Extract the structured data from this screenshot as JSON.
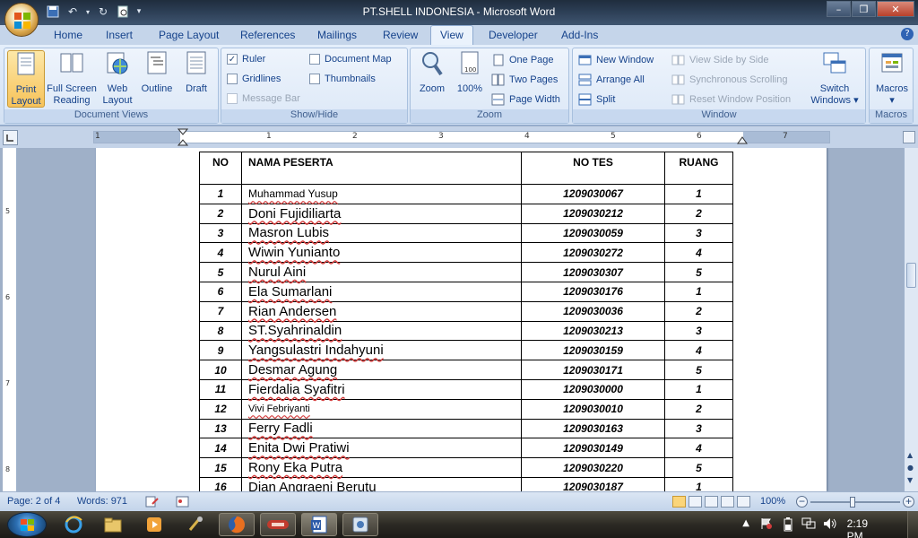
{
  "window": {
    "title": "PT.SHELL INDONESIA - Microsoft Word",
    "controls": {
      "minimize": "–",
      "maximize": "❐",
      "close": "✕"
    }
  },
  "tabs": [
    "Home",
    "Insert",
    "Page Layout",
    "References",
    "Mailings",
    "Review",
    "View",
    "Developer",
    "Add-Ins"
  ],
  "active_tab": "View",
  "ribbon": {
    "document_views": {
      "label": "Document Views",
      "buttons": [
        {
          "line1": "Print",
          "line2": "Layout"
        },
        {
          "line1": "Full Screen",
          "line2": "Reading"
        },
        {
          "line1": "Web",
          "line2": "Layout"
        },
        {
          "line1": "Outline",
          "line2": ""
        },
        {
          "line1": "Draft",
          "line2": ""
        }
      ]
    },
    "show_hide": {
      "label": "Show/Hide",
      "ruler": "Ruler",
      "gridlines": "Gridlines",
      "message_bar": "Message Bar",
      "document_map": "Document Map",
      "thumbnails": "Thumbnails"
    },
    "zoom": {
      "label": "Zoom",
      "zoom_btn": "Zoom",
      "pct_btn": "100%",
      "one_page": "One Page",
      "two_pages": "Two Pages",
      "page_width": "Page Width"
    },
    "window": {
      "label": "Window",
      "new_window": "New Window",
      "arrange_all": "Arrange All",
      "split": "Split",
      "side_by_side": "View Side by Side",
      "sync_scroll": "Synchronous Scrolling",
      "reset_pos": "Reset Window Position",
      "switch_line1": "Switch",
      "switch_line2": "Windows ▾"
    },
    "macros": {
      "label": "Macros",
      "btn": "Macros",
      "arrow": "▾"
    }
  },
  "ruler": {
    "numbers": [
      "1",
      "1",
      "2",
      "3",
      "4",
      "5",
      "6",
      "7"
    ]
  },
  "vruler": {
    "numbers": [
      "5",
      "6",
      "7",
      "8"
    ]
  },
  "table": {
    "headers": {
      "no": "NO",
      "name": "NAMA PESERTA",
      "tes": "NO TES",
      "ruang": "RUANG"
    },
    "rows": [
      {
        "no": "1",
        "name": "Muhammad  Yusup",
        "tes": "1209030067",
        "ruang": "1"
      },
      {
        "no": "2",
        "name": "Doni  Fujidiliarta",
        "tes": "1209030212",
        "ruang": "2"
      },
      {
        "no": "3",
        "name": "Masron Lubis",
        "tes": "1209030059",
        "ruang": "3"
      },
      {
        "no": "4",
        "name": "Wiwin Yunianto",
        "tes": "1209030272",
        "ruang": "4"
      },
      {
        "no": "5",
        "name": "Nurul Aini",
        "tes": "1209030307",
        "ruang": "5"
      },
      {
        "no": "6",
        "name": " Ela Sumarlani",
        "tes": "1209030176",
        "ruang": "1"
      },
      {
        "no": "7",
        "name": "Rian Andersen",
        "tes": "1209030036",
        "ruang": "2"
      },
      {
        "no": "8",
        "name": "ST.Syahrinaldin",
        "tes": "1209030213",
        "ruang": "3"
      },
      {
        "no": "9",
        "name": "Yangsulastri Indahyuni",
        "tes": "1209030159",
        "ruang": "4"
      },
      {
        "no": "10",
        "name": "Desmar Agung",
        "tes": "1209030171",
        "ruang": "5"
      },
      {
        "no": "11",
        "name": "Fierdalia Syafitri",
        "tes": "1209030000",
        "ruang": "1"
      },
      {
        "no": "12",
        "name": "Vivi Febriyanti",
        "tes": "1209030010",
        "ruang": "2"
      },
      {
        "no": "13",
        "name": "Ferry Fadli",
        "tes": "1209030163",
        "ruang": "3"
      },
      {
        "no": "14",
        "name": "Enita Dwi Pratiwi",
        "tes": "1209030149",
        "ruang": "4"
      },
      {
        "no": "15",
        "name": "Rony Eka Putra",
        "tes": "1209030220",
        "ruang": "5"
      },
      {
        "no": "16",
        "name": "Dian Angraeni Berutu",
        "tes": "1209030187",
        "ruang": "1"
      }
    ]
  },
  "status": {
    "page": "Page: 2 of 4",
    "words": "Words: 971",
    "zoom": "100%",
    "zoom_level_pct": 100
  },
  "taskbar": {
    "clock": "2:19 PM"
  },
  "colors": {
    "ribbon_text": "#15428b",
    "active_view": "#f7c35a",
    "spell_underline": "#d23c3c"
  }
}
